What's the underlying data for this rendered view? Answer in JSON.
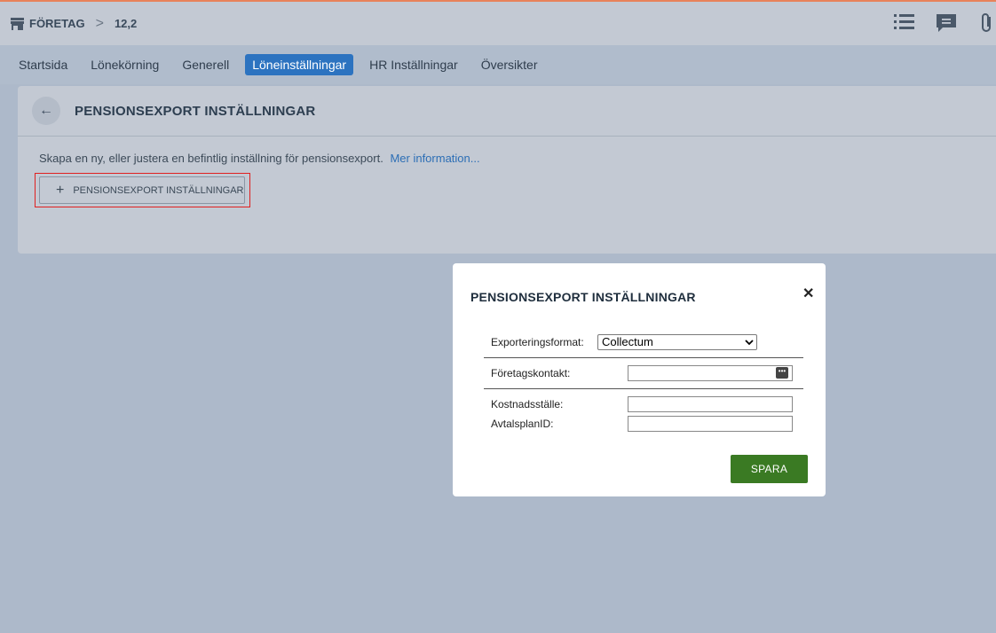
{
  "breadcrumb": {
    "company": "FÖRETAG",
    "separator": ">",
    "current": "12,2"
  },
  "top_icons": [
    "list-icon",
    "chat-icon",
    "paperclip-icon"
  ],
  "tabs": [
    {
      "label": "Startsida",
      "active": false
    },
    {
      "label": "Lönekörning",
      "active": false
    },
    {
      "label": "Generell",
      "active": false
    },
    {
      "label": "Löneinställningar",
      "active": true
    },
    {
      "label": "HR Inställningar",
      "active": false
    },
    {
      "label": "Översikter",
      "active": false
    }
  ],
  "panel": {
    "back_icon": "arrow-left-icon",
    "title": "PENSIONSEXPORT INSTÄLLNINGAR",
    "description": "Skapa en ny, eller justera en befintlig inställning för pensionsexport.",
    "more_link": "Mer information...",
    "add_button": {
      "icon": "plus-icon",
      "label": "PENSIONSEXPORT INSTÄLLNINGAR"
    }
  },
  "modal": {
    "title": "PENSIONSEXPORT INSTÄLLNINGAR",
    "close_icon": "close-icon",
    "format_label": "Exporteringsformat:",
    "format_value": "Collectum",
    "contact_label": "Företagskontakt:",
    "contact_value": "",
    "cost_center_label": "Kostnadsställe:",
    "cost_center_value": "",
    "plan_id_label": "AvtalsplanID:",
    "plan_id_value": "",
    "save_label": "SPARA"
  },
  "colors": {
    "accent_tab": "#2c73c0",
    "save_button": "#3a7a23",
    "highlight_outline": "#e02020",
    "link": "#2c6eb5"
  }
}
